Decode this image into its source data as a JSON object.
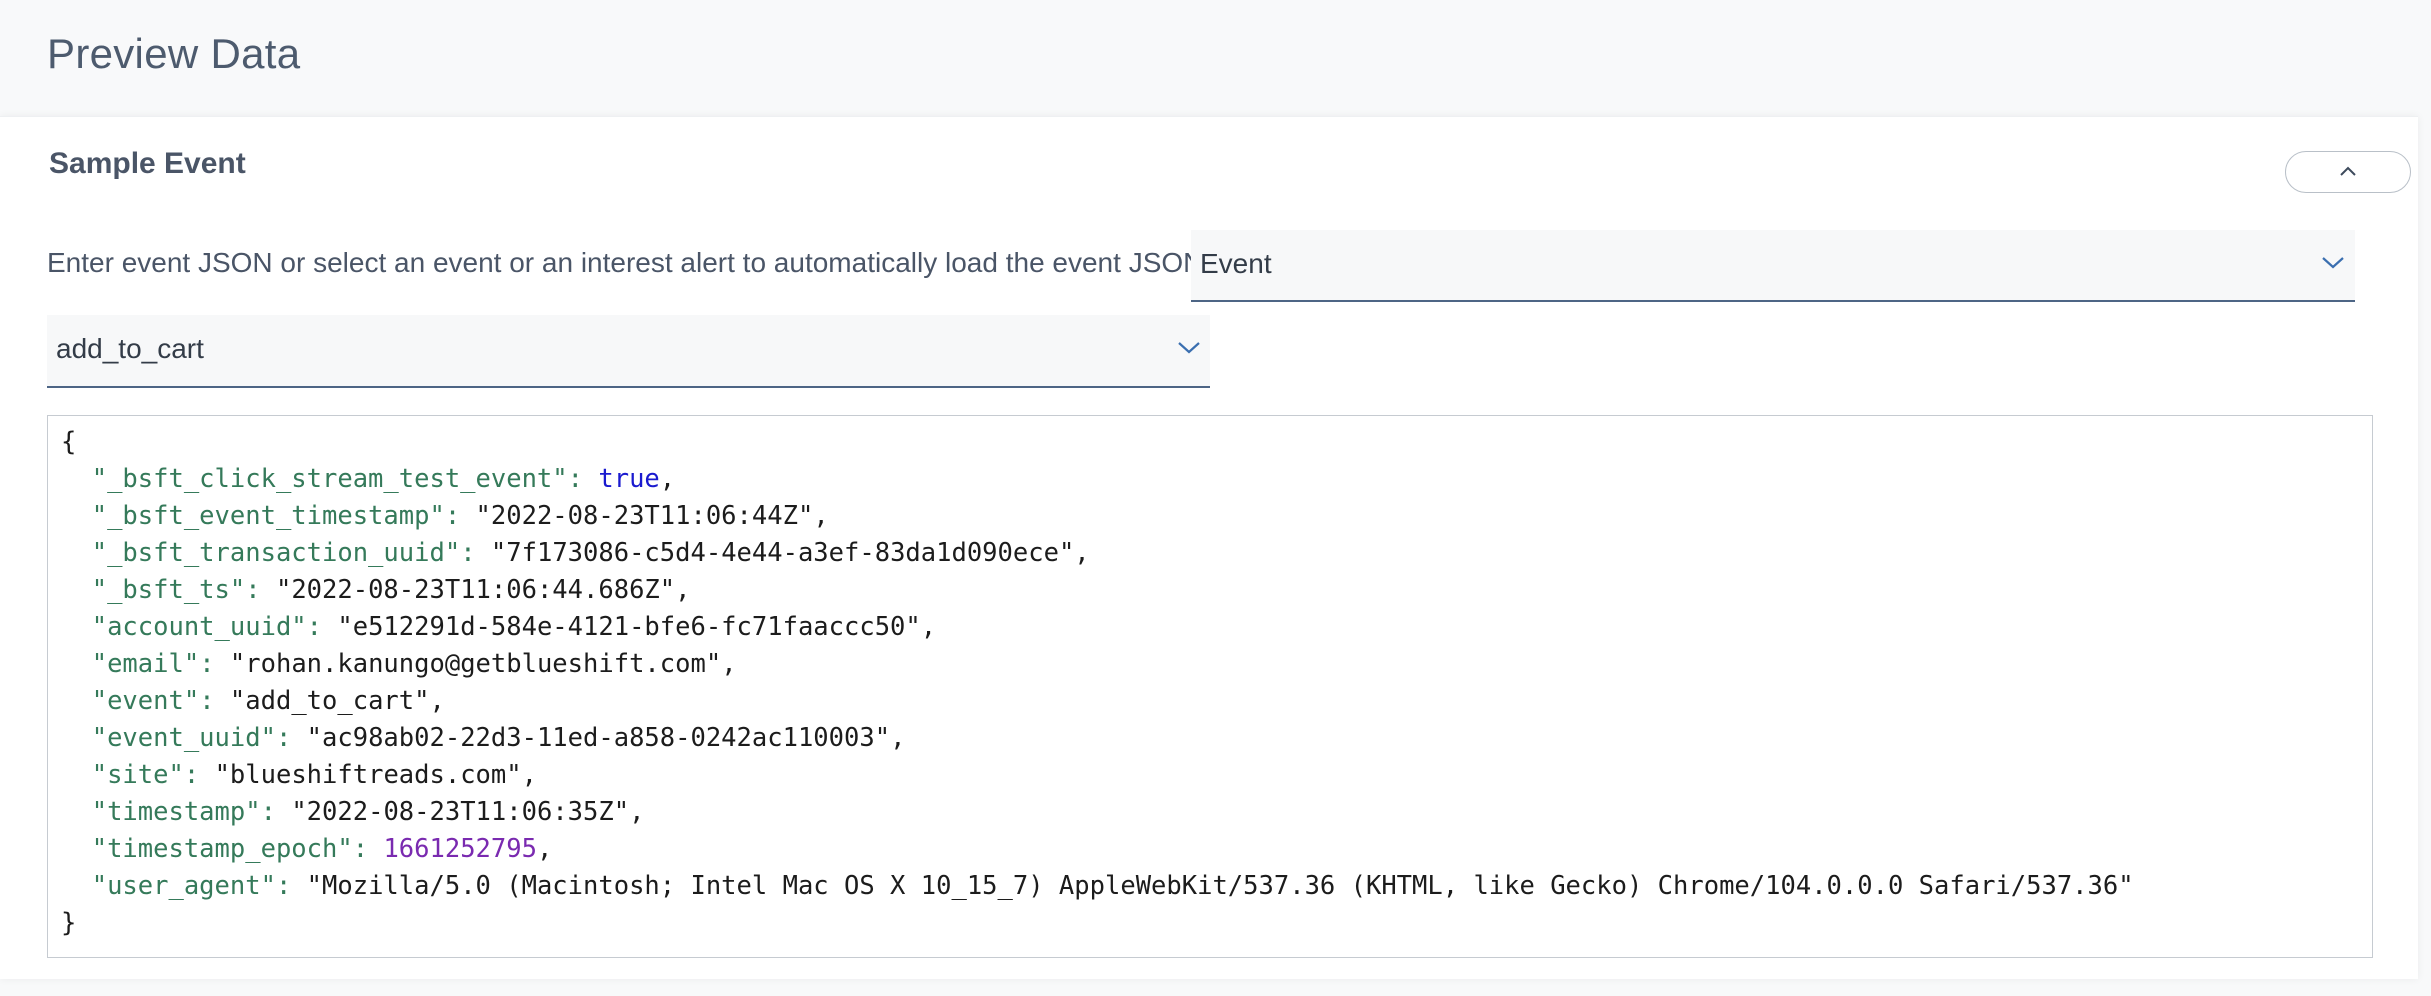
{
  "page": {
    "title": "Preview Data"
  },
  "sample_event": {
    "title": "Sample Event",
    "collapse_icon": "chevron-up-icon",
    "instruction": "Enter event JSON or select an event or an interest alert to automatically load the event JSON",
    "source_select": {
      "value": "Event",
      "icon": "chevron-down-icon"
    },
    "event_select": {
      "value": "add_to_cart",
      "icon": "chevron-down-icon"
    }
  },
  "json_editor": {
    "open_brace": "{",
    "close_brace": "}",
    "entries": [
      {
        "key": "\"_bsft_click_stream_test_event\"",
        "value": "true",
        "type": "bool",
        "comma": ","
      },
      {
        "key": "\"_bsft_event_timestamp\"",
        "value": "\"2022-08-23T11:06:44Z\"",
        "type": "string",
        "comma": ","
      },
      {
        "key": "\"_bsft_transaction_uuid\"",
        "value": "\"7f173086-c5d4-4e44-a3ef-83da1d090ece\"",
        "type": "string",
        "comma": ","
      },
      {
        "key": "\"_bsft_ts\"",
        "value": "\"2022-08-23T11:06:44.686Z\"",
        "type": "string",
        "comma": ","
      },
      {
        "key": "\"account_uuid\"",
        "value": "\"e512291d-584e-4121-bfe6-fc71faaccc50\"",
        "type": "string",
        "comma": ","
      },
      {
        "key": "\"email\"",
        "value": "\"rohan.kanungo@getblueshift.com\"",
        "type": "string",
        "comma": ","
      },
      {
        "key": "\"event\"",
        "value": "\"add_to_cart\"",
        "type": "string",
        "comma": ","
      },
      {
        "key": "\"event_uuid\"",
        "value": "\"ac98ab02-22d3-11ed-a858-0242ac110003\"",
        "type": "string",
        "comma": ","
      },
      {
        "key": "\"site\"",
        "value": "\"blueshiftreads.com\"",
        "type": "string",
        "comma": ","
      },
      {
        "key": "\"timestamp\"",
        "value": "\"2022-08-23T11:06:35Z\"",
        "type": "string",
        "comma": ","
      },
      {
        "key": "\"timestamp_epoch\"",
        "value": "1661252795",
        "type": "number",
        "comma": ","
      },
      {
        "key": "\"user_agent\"",
        "value": "\"Mozilla/5.0 (Macintosh; Intel Mac OS X 10_15_7) AppleWebKit/537.36 (KHTML, like Gecko) Chrome/104.0.0.0 Safari/537.36\"",
        "type": "string",
        "comma": ""
      }
    ]
  },
  "colors": {
    "key": "#357a5a",
    "bool": "#1a1acf",
    "number": "#7a2ab0",
    "string": "#1c1c1c",
    "select_underline": "#4d6585",
    "chevron": "#3b6fb0"
  }
}
